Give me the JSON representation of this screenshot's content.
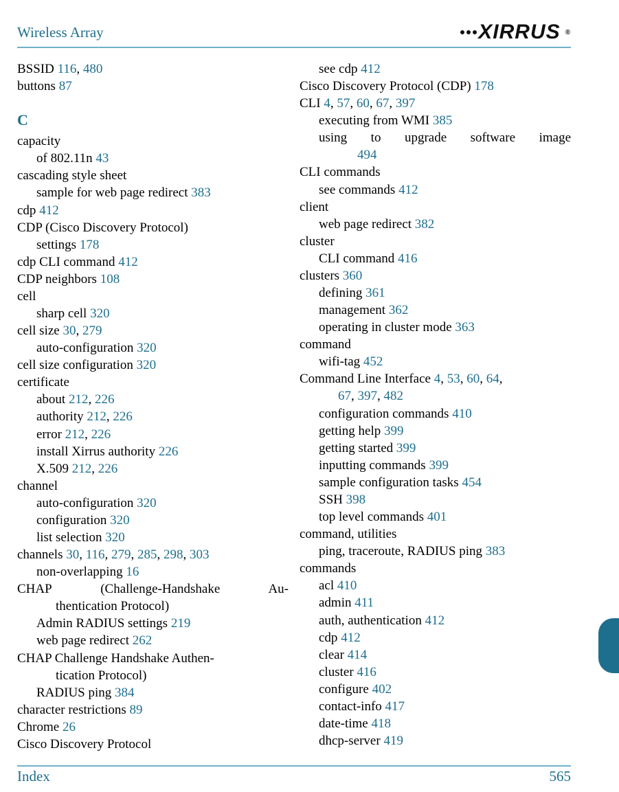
{
  "header": {
    "title": "Wireless Array",
    "logo_text": "XIRRUS"
  },
  "footer": {
    "label": "Index",
    "page": "565"
  },
  "left": [
    {
      "lvl": 0,
      "parts": [
        {
          "t": "BSSID "
        },
        {
          "t": "116",
          "p": 1
        },
        {
          "t": ", "
        },
        {
          "t": "480",
          "p": 1
        }
      ]
    },
    {
      "lvl": 0,
      "parts": [
        {
          "t": "buttons "
        },
        {
          "t": "87",
          "p": 1
        }
      ]
    },
    {
      "section": "C"
    },
    {
      "lvl": 0,
      "parts": [
        {
          "t": "capacity"
        }
      ]
    },
    {
      "lvl": 1,
      "parts": [
        {
          "t": "of 802.11n "
        },
        {
          "t": "43",
          "p": 1
        }
      ]
    },
    {
      "lvl": 0,
      "parts": [
        {
          "t": "cascading style sheet"
        }
      ]
    },
    {
      "lvl": 1,
      "parts": [
        {
          "t": "sample for web page redirect "
        },
        {
          "t": "383",
          "p": 1
        }
      ]
    },
    {
      "lvl": 0,
      "parts": [
        {
          "t": "cdp "
        },
        {
          "t": "412",
          "p": 1
        }
      ]
    },
    {
      "lvl": 0,
      "parts": [
        {
          "t": "CDP (Cisco Discovery Protocol)"
        }
      ]
    },
    {
      "lvl": 1,
      "parts": [
        {
          "t": "settings "
        },
        {
          "t": "178",
          "p": 1
        }
      ]
    },
    {
      "lvl": 0,
      "parts": [
        {
          "t": "cdp CLI command "
        },
        {
          "t": "412",
          "p": 1
        }
      ]
    },
    {
      "lvl": 0,
      "parts": [
        {
          "t": "CDP neighbors "
        },
        {
          "t": "108",
          "p": 1
        }
      ]
    },
    {
      "lvl": 0,
      "parts": [
        {
          "t": "cell"
        }
      ]
    },
    {
      "lvl": 1,
      "parts": [
        {
          "t": "sharp cell "
        },
        {
          "t": "320",
          "p": 1
        }
      ]
    },
    {
      "lvl": 0,
      "parts": [
        {
          "t": "cell size "
        },
        {
          "t": "30",
          "p": 1
        },
        {
          "t": ", "
        },
        {
          "t": "279",
          "p": 1
        }
      ]
    },
    {
      "lvl": 1,
      "parts": [
        {
          "t": "auto-configuration "
        },
        {
          "t": "320",
          "p": 1
        }
      ]
    },
    {
      "lvl": 0,
      "parts": [
        {
          "t": "cell size configuration "
        },
        {
          "t": "320",
          "p": 1
        }
      ]
    },
    {
      "lvl": 0,
      "parts": [
        {
          "t": "certificate"
        }
      ]
    },
    {
      "lvl": 1,
      "parts": [
        {
          "t": "about "
        },
        {
          "t": "212",
          "p": 1
        },
        {
          "t": ", "
        },
        {
          "t": "226",
          "p": 1
        }
      ]
    },
    {
      "lvl": 1,
      "parts": [
        {
          "t": "authority "
        },
        {
          "t": "212",
          "p": 1
        },
        {
          "t": ", "
        },
        {
          "t": "226",
          "p": 1
        }
      ]
    },
    {
      "lvl": 1,
      "parts": [
        {
          "t": "error "
        },
        {
          "t": "212",
          "p": 1
        },
        {
          "t": ", "
        },
        {
          "t": "226",
          "p": 1
        }
      ]
    },
    {
      "lvl": 1,
      "parts": [
        {
          "t": "install Xirrus authority "
        },
        {
          "t": "226",
          "p": 1
        }
      ]
    },
    {
      "lvl": 1,
      "parts": [
        {
          "t": "X.509 "
        },
        {
          "t": "212",
          "p": 1
        },
        {
          "t": ", "
        },
        {
          "t": "226",
          "p": 1
        }
      ]
    },
    {
      "lvl": 0,
      "parts": [
        {
          "t": "channel"
        }
      ]
    },
    {
      "lvl": 1,
      "parts": [
        {
          "t": "auto-configuration "
        },
        {
          "t": "320",
          "p": 1
        }
      ]
    },
    {
      "lvl": 1,
      "parts": [
        {
          "t": "configuration "
        },
        {
          "t": "320",
          "p": 1
        }
      ]
    },
    {
      "lvl": 1,
      "parts": [
        {
          "t": "list selection "
        },
        {
          "t": "320",
          "p": 1
        }
      ]
    },
    {
      "lvl": 0,
      "parts": [
        {
          "t": "channels "
        },
        {
          "t": "30",
          "p": 1
        },
        {
          "t": ", "
        },
        {
          "t": "116",
          "p": 1
        },
        {
          "t": ", "
        },
        {
          "t": "279",
          "p": 1
        },
        {
          "t": ", "
        },
        {
          "t": "285",
          "p": 1
        },
        {
          "t": ", "
        },
        {
          "t": "298",
          "p": 1
        },
        {
          "t": ", "
        },
        {
          "t": "303",
          "p": 1
        }
      ]
    },
    {
      "lvl": 1,
      "parts": [
        {
          "t": "non-overlapping "
        },
        {
          "t": "16",
          "p": 1
        }
      ]
    },
    {
      "lvl": 0,
      "justify": true,
      "parts": [
        {
          "t": "CHAP (Challenge-Handshake Au-"
        }
      ]
    },
    {
      "lvl": 1,
      "cont": true,
      "parts": [
        {
          "t": "thentication Protocol)"
        }
      ]
    },
    {
      "lvl": 1,
      "parts": [
        {
          "t": "Admin RADIUS settings "
        },
        {
          "t": "219",
          "p": 1
        }
      ]
    },
    {
      "lvl": 1,
      "parts": [
        {
          "t": "web page redirect "
        },
        {
          "t": "262",
          "p": 1
        }
      ]
    },
    {
      "lvl": 0,
      "parts": [
        {
          "t": "CHAP Challenge Handshake Authen-"
        }
      ]
    },
    {
      "lvl": 1,
      "cont": true,
      "parts": [
        {
          "t": "tication Protocol)"
        }
      ]
    },
    {
      "lvl": 1,
      "parts": [
        {
          "t": "RADIUS ping "
        },
        {
          "t": "384",
          "p": 1
        }
      ]
    },
    {
      "lvl": 0,
      "parts": [
        {
          "t": "character restrictions "
        },
        {
          "t": "89",
          "p": 1
        }
      ]
    },
    {
      "lvl": 0,
      "parts": [
        {
          "t": "Chrome "
        },
        {
          "t": "26",
          "p": 1
        }
      ]
    },
    {
      "lvl": 0,
      "parts": [
        {
          "t": "Cisco Discovery Protocol"
        }
      ]
    }
  ],
  "right": [
    {
      "lvl": 1,
      "parts": [
        {
          "t": "see cdp "
        },
        {
          "t": "412",
          "p": 1
        }
      ]
    },
    {
      "lvl": 0,
      "parts": [
        {
          "t": "Cisco Discovery Protocol (CDP) "
        },
        {
          "t": "178",
          "p": 1
        }
      ]
    },
    {
      "lvl": 0,
      "parts": [
        {
          "t": "CLI "
        },
        {
          "t": "4",
          "p": 1
        },
        {
          "t": ", "
        },
        {
          "t": "57",
          "p": 1
        },
        {
          "t": ", "
        },
        {
          "t": "60",
          "p": 1
        },
        {
          "t": ", "
        },
        {
          "t": "67",
          "p": 1
        },
        {
          "t": ", "
        },
        {
          "t": "397",
          "p": 1
        }
      ]
    },
    {
      "lvl": 1,
      "parts": [
        {
          "t": "executing from WMI "
        },
        {
          "t": "385",
          "p": 1
        }
      ]
    },
    {
      "lvl": 1,
      "justify": true,
      "parts": [
        {
          "t": "using to upgrade software image"
        }
      ]
    },
    {
      "lvl": 2,
      "cont": true,
      "parts": [
        {
          "t": "494",
          "p": 1
        }
      ]
    },
    {
      "lvl": 0,
      "parts": [
        {
          "t": "CLI commands"
        }
      ]
    },
    {
      "lvl": 1,
      "parts": [
        {
          "t": "see commands "
        },
        {
          "t": "412",
          "p": 1
        }
      ]
    },
    {
      "lvl": 0,
      "parts": [
        {
          "t": "client"
        }
      ]
    },
    {
      "lvl": 1,
      "parts": [
        {
          "t": "web page redirect "
        },
        {
          "t": "382",
          "p": 1
        }
      ]
    },
    {
      "lvl": 0,
      "parts": [
        {
          "t": "cluster"
        }
      ]
    },
    {
      "lvl": 1,
      "parts": [
        {
          "t": "CLI command "
        },
        {
          "t": "416",
          "p": 1
        }
      ]
    },
    {
      "lvl": 0,
      "parts": [
        {
          "t": "clusters "
        },
        {
          "t": "360",
          "p": 1
        }
      ]
    },
    {
      "lvl": 1,
      "parts": [
        {
          "t": "defining "
        },
        {
          "t": "361",
          "p": 1
        }
      ]
    },
    {
      "lvl": 1,
      "parts": [
        {
          "t": "management "
        },
        {
          "t": "362",
          "p": 1
        }
      ]
    },
    {
      "lvl": 1,
      "parts": [
        {
          "t": "operating in cluster mode "
        },
        {
          "t": "363",
          "p": 1
        }
      ]
    },
    {
      "lvl": 0,
      "parts": [
        {
          "t": "command"
        }
      ]
    },
    {
      "lvl": 1,
      "parts": [
        {
          "t": "wifi-tag "
        },
        {
          "t": "452",
          "p": 1
        }
      ]
    },
    {
      "lvl": 0,
      "parts": [
        {
          "t": "Command Line Interface "
        },
        {
          "t": "4",
          "p": 1
        },
        {
          "t": ", "
        },
        {
          "t": "53",
          "p": 1
        },
        {
          "t": ", "
        },
        {
          "t": "60",
          "p": 1
        },
        {
          "t": ", "
        },
        {
          "t": "64",
          "p": 1
        },
        {
          "t": ", "
        }
      ]
    },
    {
      "lvl": 1,
      "cont": true,
      "parts": [
        {
          "t": "67",
          "p": 1
        },
        {
          "t": ", "
        },
        {
          "t": "397",
          "p": 1
        },
        {
          "t": ", "
        },
        {
          "t": "482",
          "p": 1
        }
      ]
    },
    {
      "lvl": 1,
      "parts": [
        {
          "t": "configuration commands "
        },
        {
          "t": "410",
          "p": 1
        }
      ]
    },
    {
      "lvl": 1,
      "parts": [
        {
          "t": "getting help "
        },
        {
          "t": "399",
          "p": 1
        }
      ]
    },
    {
      "lvl": 1,
      "parts": [
        {
          "t": "getting started "
        },
        {
          "t": "399",
          "p": 1
        }
      ]
    },
    {
      "lvl": 1,
      "parts": [
        {
          "t": "inputting commands "
        },
        {
          "t": "399",
          "p": 1
        }
      ]
    },
    {
      "lvl": 1,
      "parts": [
        {
          "t": "sample configuration tasks "
        },
        {
          "t": "454",
          "p": 1
        }
      ]
    },
    {
      "lvl": 1,
      "parts": [
        {
          "t": "SSH "
        },
        {
          "t": "398",
          "p": 1
        }
      ]
    },
    {
      "lvl": 1,
      "parts": [
        {
          "t": "top level commands "
        },
        {
          "t": "401",
          "p": 1
        }
      ]
    },
    {
      "lvl": 0,
      "parts": [
        {
          "t": "command, utilities"
        }
      ]
    },
    {
      "lvl": 1,
      "parts": [
        {
          "t": "ping, traceroute, RADIUS ping "
        },
        {
          "t": "383",
          "p": 1
        }
      ]
    },
    {
      "lvl": 0,
      "parts": [
        {
          "t": "commands"
        }
      ]
    },
    {
      "lvl": 1,
      "parts": [
        {
          "t": "acl "
        },
        {
          "t": "410",
          "p": 1
        }
      ]
    },
    {
      "lvl": 1,
      "parts": [
        {
          "t": "admin "
        },
        {
          "t": "411",
          "p": 1
        }
      ]
    },
    {
      "lvl": 1,
      "parts": [
        {
          "t": "auth, authentication "
        },
        {
          "t": "412",
          "p": 1
        }
      ]
    },
    {
      "lvl": 1,
      "parts": [
        {
          "t": "cdp "
        },
        {
          "t": "412",
          "p": 1
        }
      ]
    },
    {
      "lvl": 1,
      "parts": [
        {
          "t": "clear "
        },
        {
          "t": "414",
          "p": 1
        }
      ]
    },
    {
      "lvl": 1,
      "parts": [
        {
          "t": "cluster "
        },
        {
          "t": "416",
          "p": 1
        }
      ]
    },
    {
      "lvl": 1,
      "parts": [
        {
          "t": "configure "
        },
        {
          "t": "402",
          "p": 1
        }
      ]
    },
    {
      "lvl": 1,
      "parts": [
        {
          "t": "contact-info "
        },
        {
          "t": "417",
          "p": 1
        }
      ]
    },
    {
      "lvl": 1,
      "parts": [
        {
          "t": "date-time "
        },
        {
          "t": "418",
          "p": 1
        }
      ]
    },
    {
      "lvl": 1,
      "parts": [
        {
          "t": "dhcp-server "
        },
        {
          "t": "419",
          "p": 1
        }
      ]
    }
  ]
}
